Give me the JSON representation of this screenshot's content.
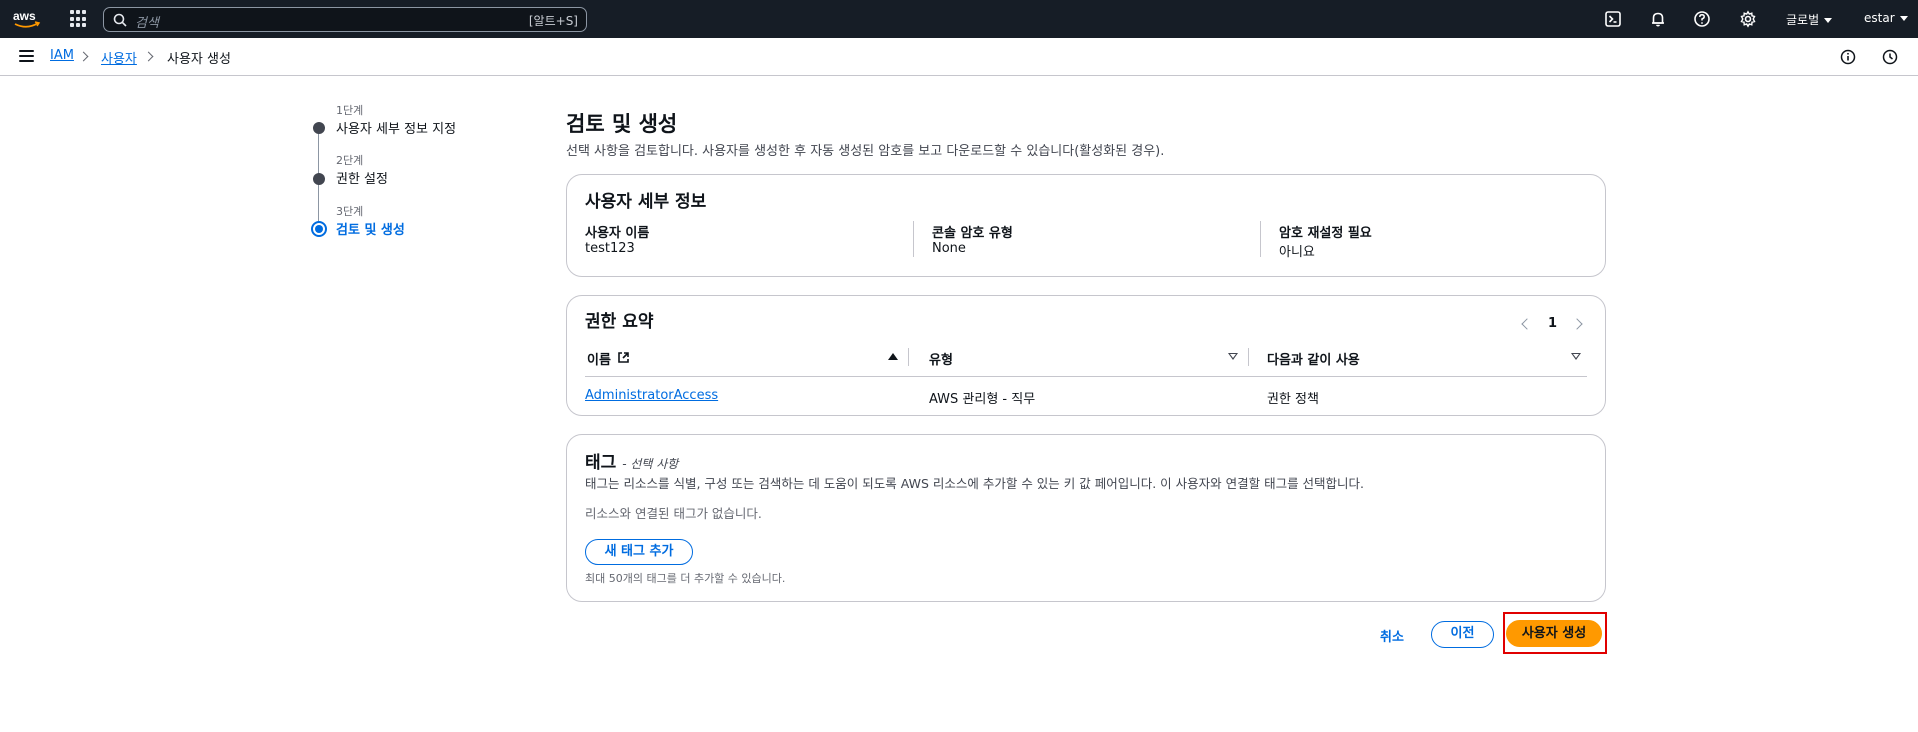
{
  "topnav": {
    "logo": "aws",
    "search_placeholder": "검색",
    "search_shortcut": "[알트+S]",
    "region_label": "글로벌",
    "account_label": "estar",
    "icons": [
      "cloudshell-icon",
      "bell-icon",
      "help-icon",
      "gear-icon"
    ]
  },
  "breadcrumb": {
    "items": [
      "IAM",
      "사용자",
      "사용자 생성"
    ]
  },
  "steps": [
    {
      "num": "1단계",
      "title": "사용자 세부 정보 지정"
    },
    {
      "num": "2단계",
      "title": "권한 설정"
    },
    {
      "num": "3단계",
      "title": "검토 및 생성"
    }
  ],
  "page": {
    "title": "검토 및 생성",
    "description": "선택 사항을 검토합니다. 사용자를 생성한 후 자동 생성된 암호를 보고 다운로드할 수 있습니다(활성화된 경우)."
  },
  "user_details": {
    "title": "사용자 세부 정보",
    "fields": [
      {
        "label": "사용자 이름",
        "value": "test123"
      },
      {
        "label": "콘솔 암호 유형",
        "value": "None"
      },
      {
        "label": "암호 재설정 필요",
        "value": "아니요"
      }
    ]
  },
  "permissions": {
    "title": "권한 요약",
    "page": "1",
    "columns": [
      "이름",
      "유형",
      "다음과 같이 사용"
    ],
    "rows": [
      {
        "name": "AdministratorAccess",
        "type": "AWS 관리형 - 직무",
        "used_as": "권한 정책"
      }
    ]
  },
  "tags": {
    "title": "태그",
    "optional": "- 선택 사항",
    "description": "태그는 리소스를 식별, 구성 또는 검색하는 데 도움이 되도록 AWS 리소스에 추가할 수 있는 키 값 페어입니다. 이 사용자와 연결할 태그를 선택합니다.",
    "empty": "리소스와 연결된 태그가 없습니다.",
    "add_button": "새 태그 추가",
    "hint": "최대 50개의 태그를 더 추가할 수 있습니다."
  },
  "actions": {
    "cancel": "취소",
    "previous": "이전",
    "create": "사용자 생성"
  },
  "colors": {
    "primary": "#ff9900",
    "link": "#006ce0",
    "nav_bg": "#161d26",
    "highlight": "#e00000"
  }
}
